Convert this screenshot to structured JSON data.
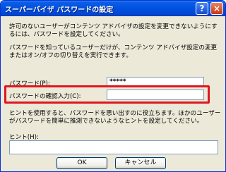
{
  "window": {
    "title": "スーパーバイザ パスワードの設定",
    "help_label": "?",
    "close_label": "×"
  },
  "texts": {
    "para1": "許可のないユーザーがコンテンツ アドバイザの設定を変更できないようにするには、パスワードを設定してください。",
    "para2": "パスワードを知っているユーザーだけが、コンテンツ アドバイザ設定の変更またはオン/オフの切り替えを実行できます。",
    "para3": "ヒントを使用すると、パスワードを思い出すのに役立ちます。ほかのユーザーがパスワードを簡単に推測できないようなヒントを設定してください。"
  },
  "form": {
    "password_label": "パスワード(P):",
    "password_value": "*****",
    "confirm_label": "パスワードの確認入力(C):",
    "confirm_value": "",
    "hint_label": "ヒント(H):",
    "hint_value": ""
  },
  "buttons": {
    "ok": "OK",
    "cancel": "キャンセル"
  },
  "colors": {
    "highlight": "#e0161e",
    "titlebar": "#0050e0"
  }
}
